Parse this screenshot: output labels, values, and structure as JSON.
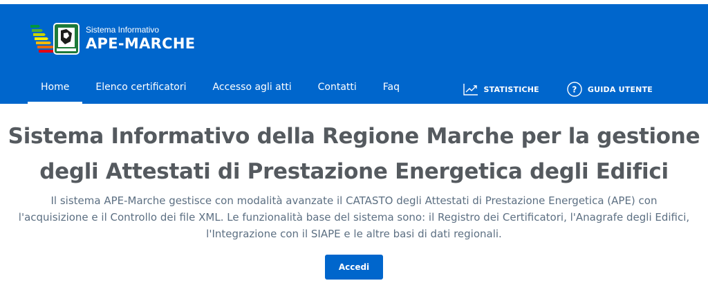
{
  "brand": {
    "subtitle": "Sistema Informativo",
    "title": "APE-MARCHE",
    "logo_icon": "energy-class-marche-logo"
  },
  "nav": {
    "items": [
      {
        "label": "Home",
        "active": true
      },
      {
        "label": "Elenco certificatori",
        "active": false
      },
      {
        "label": "Accesso agli atti",
        "active": false
      },
      {
        "label": "Contatti",
        "active": false
      },
      {
        "label": "Faq",
        "active": false
      }
    ]
  },
  "tools": {
    "statistics": {
      "label": "STATISTICHE",
      "icon": "chart-line-icon"
    },
    "guide": {
      "label": "GUIDA UTENTE",
      "icon": "help-circle-icon"
    }
  },
  "main": {
    "title_line1": "Sistema Informativo della Regione Marche per la gestione",
    "title_line2": "degli Attestati di Prestazione Energetica degli Edifici",
    "desc_line1": "Il sistema APE-Marche gestisce con modalità avanzate il CATASTO degli Attestati di Prestazione Energetica (APE) con",
    "desc_line2": "l'acquisizione e il Controllo dei file XML. Le funzionalità base del sistema sono: il Registro dei Certificatori, l'Anagrafe degli Edifici,",
    "desc_line3": "l'Integrazione con il SIAPE e le altre basi di dati regionali.",
    "button_label": "Accedi"
  },
  "colors": {
    "primary": "#0066cc",
    "title_text": "#555a5f",
    "body_text": "#5c6f82"
  }
}
